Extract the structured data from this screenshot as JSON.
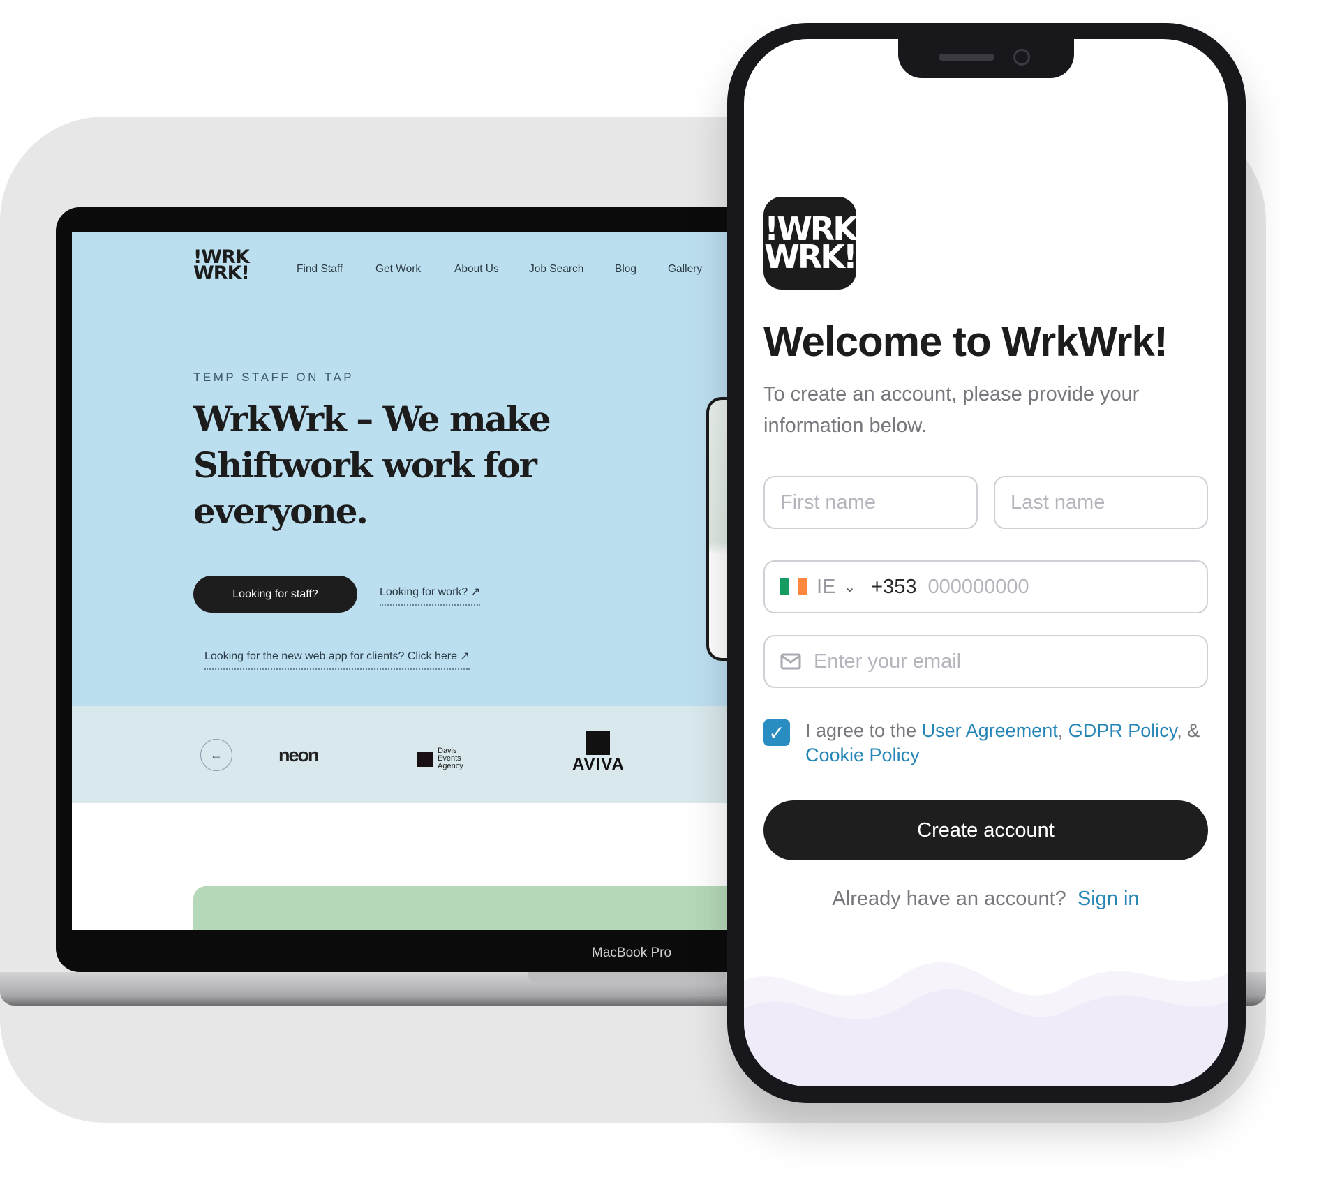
{
  "laptop": {
    "label": "MacBook Pro",
    "site": {
      "logo": [
        "!WRK",
        "WRK!"
      ],
      "nav": [
        "Find Staff",
        "Get Work",
        "About Us",
        "Job Search",
        "Blog",
        "Gallery"
      ],
      "eyebrow": "TEMP STAFF ON TAP",
      "headline": "WrkWrk – We make Shiftwork work for everyone.",
      "primary_button": "Looking for staff?",
      "work_link": "Looking for work? ↗",
      "client_link": "Looking for the new web app for clients? Click here ↗",
      "partners": [
        "neon",
        "Davis Events Agency",
        "AVIVA"
      ],
      "colors": {
        "hero": "#bcdff0",
        "logos_band": "#d9e8ec",
        "green_card": "#b5d9b8"
      }
    }
  },
  "phone": {
    "logo": [
      "!WRK",
      "WRK!"
    ],
    "title": "Welcome to WrkWrk!",
    "subtitle": "To create an account, please provide your information below.",
    "first_name_placeholder": "First name",
    "last_name_placeholder": "Last name",
    "country": "IE",
    "dial_code": "+353",
    "phone_placeholder": "000000000",
    "email_placeholder": "Enter your email",
    "agree_prefix": "I agree to the ",
    "user_agreement": "User Agreement",
    "gdpr": "GDPR Policy",
    "cookie": "Cookie Policy",
    "agreed": true,
    "create_button": "Create account",
    "already": "Already have an account?",
    "sign_in": "Sign in",
    "accent": "#2585b5"
  }
}
